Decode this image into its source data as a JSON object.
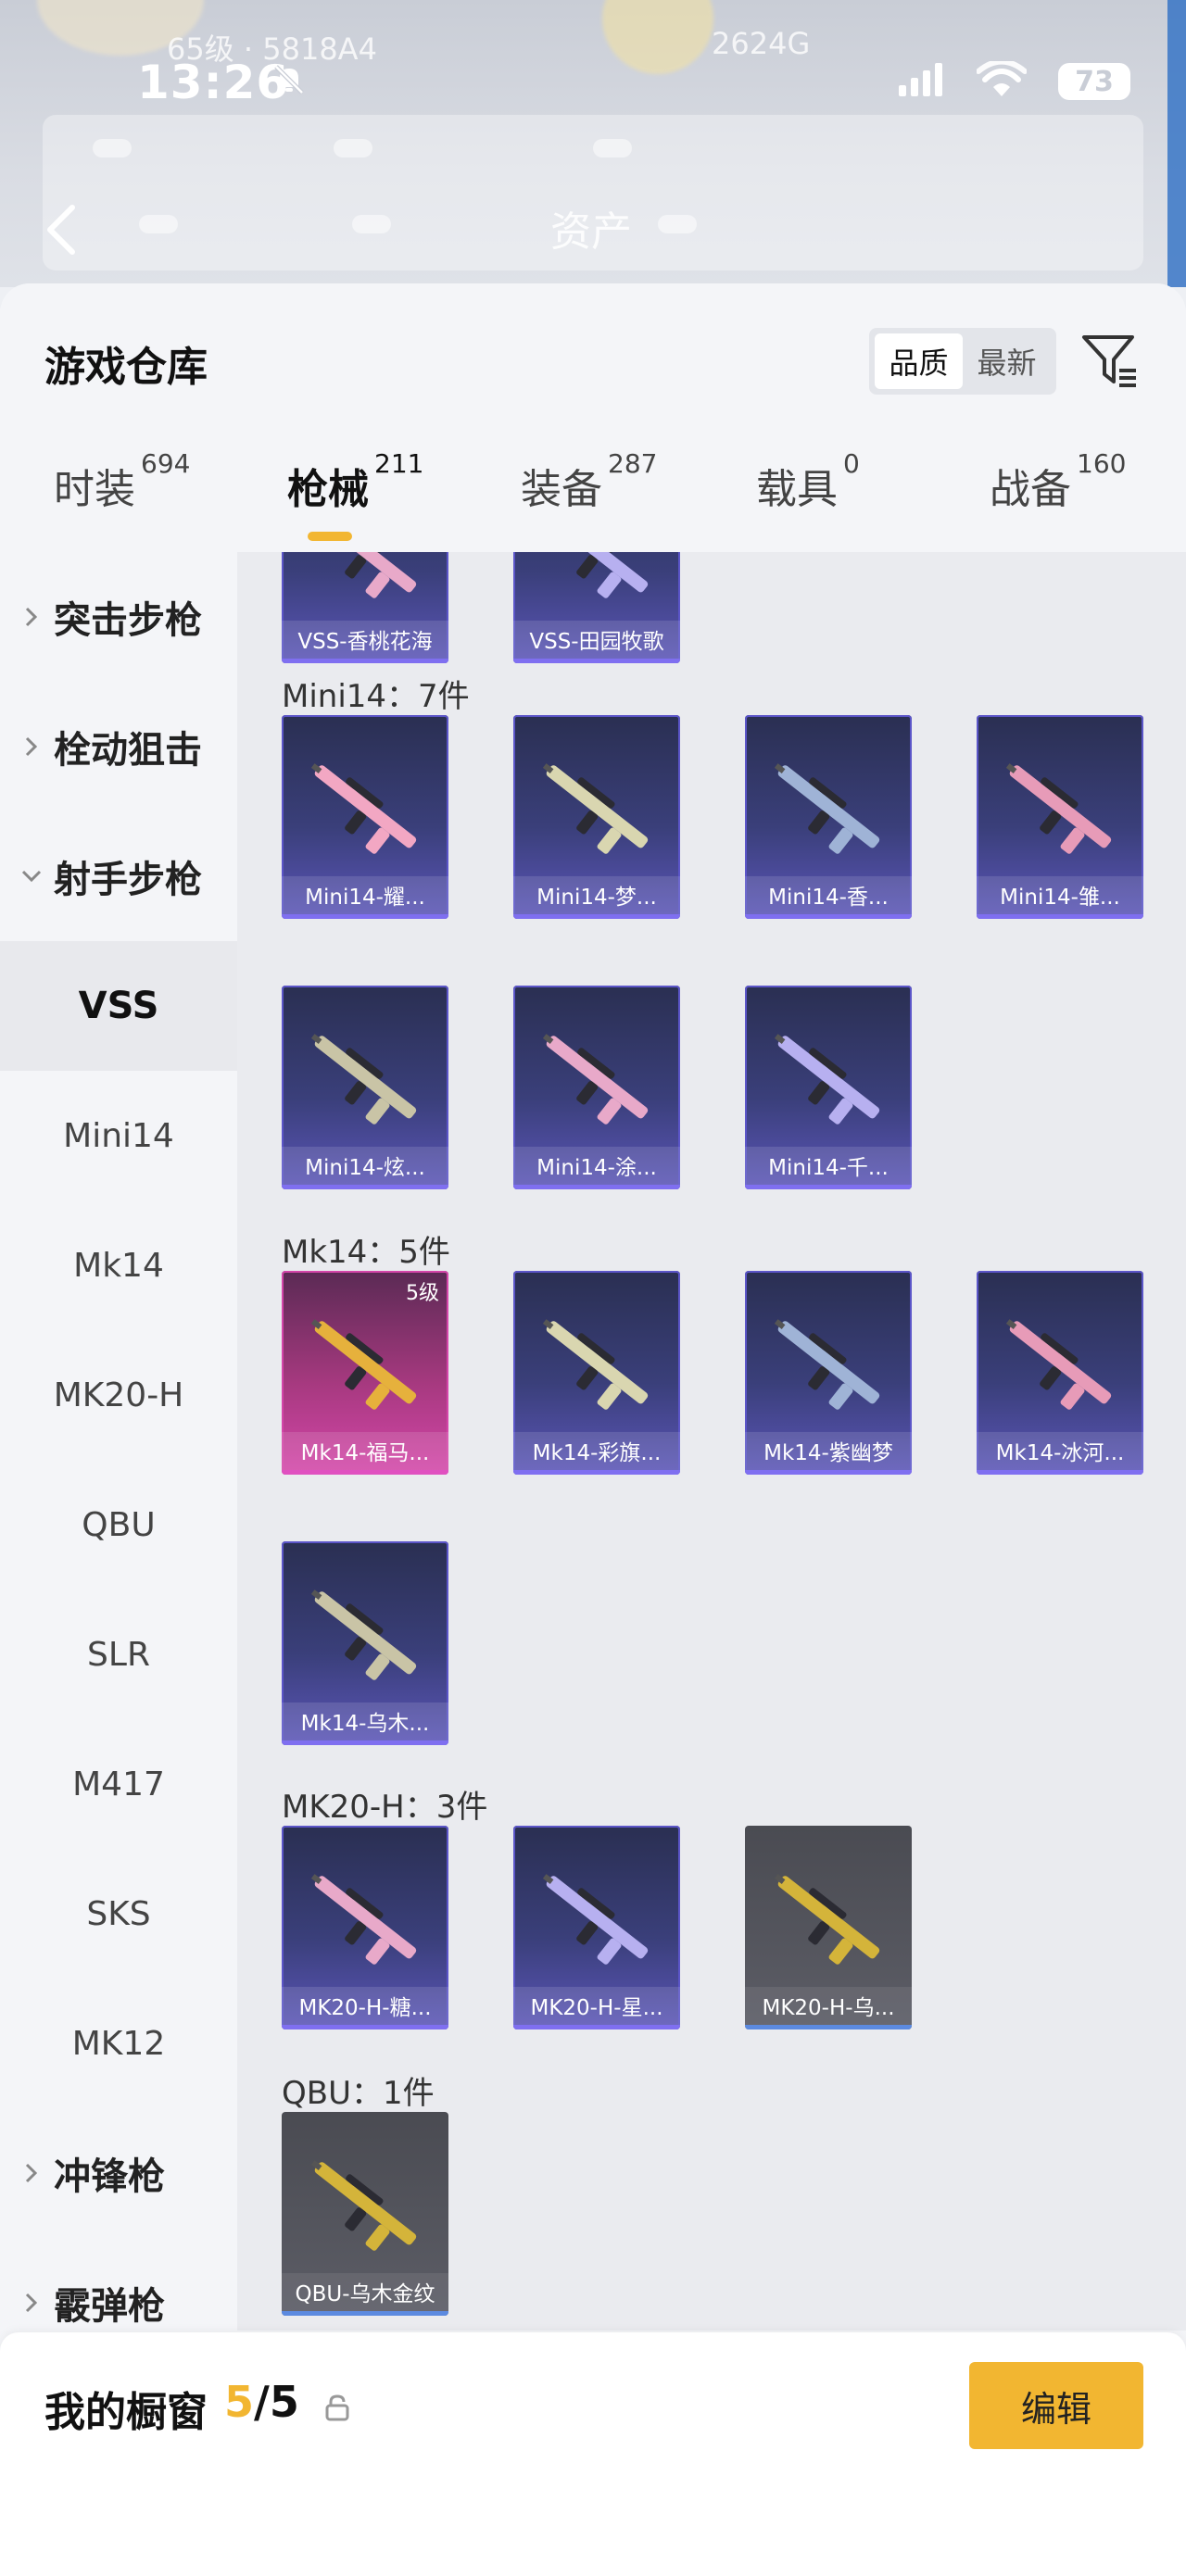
{
  "status_bar": {
    "time": "13:26",
    "battery": "73"
  },
  "background": {
    "faint_left": "65级 · 5818A4",
    "faint_right": "2624G",
    "assets_label": "资产"
  },
  "colors": {
    "accent": "#f2b631",
    "card_purple": "#3a3f7a",
    "card_pink": "#d446a9",
    "card_gray": "#5c5d66"
  },
  "sheet": {
    "title": "游戏仓库",
    "sort_options": [
      "品质",
      "最新"
    ],
    "sort_active": "品质",
    "tabs": [
      {
        "label": "时装",
        "count": "694"
      },
      {
        "label": "枪械",
        "count": "211"
      },
      {
        "label": "装备",
        "count": "287"
      },
      {
        "label": "载具",
        "count": "0"
      },
      {
        "label": "战备",
        "count": "160"
      }
    ],
    "active_tab": "枪械"
  },
  "sidebar": {
    "groups": [
      {
        "label": "突击步枪",
        "expanded": false
      },
      {
        "label": "栓动狙击",
        "expanded": false
      },
      {
        "label": "射手步枪",
        "expanded": true
      }
    ],
    "subs": [
      "VSS",
      "Mini14",
      "Mk14",
      "MK20-H",
      "QBU",
      "SLR",
      "M417",
      "SKS",
      "MK12"
    ],
    "active_sub": "VSS",
    "groups_after": [
      {
        "label": "冲锋枪",
        "expanded": false
      },
      {
        "label": "霰弹枪",
        "expanded": false
      }
    ]
  },
  "content": {
    "vss_tail": [
      {
        "name": "VSS-香桃花海",
        "rarity": "purple"
      },
      {
        "name": "VSS-田园牧歌",
        "rarity": "purple"
      }
    ],
    "groups": [
      {
        "title": "Mini14：7件",
        "items": [
          {
            "name": "Mini14-耀...",
            "rarity": "purple"
          },
          {
            "name": "Mini14-梦...",
            "rarity": "purple"
          },
          {
            "name": "Mini14-香...",
            "rarity": "purple"
          },
          {
            "name": "Mini14-雏...",
            "rarity": "purple"
          },
          {
            "name": "Mini14-炫...",
            "rarity": "purple"
          },
          {
            "name": "Mini14-涂...",
            "rarity": "purple"
          },
          {
            "name": "Mini14-千...",
            "rarity": "purple"
          }
        ]
      },
      {
        "title": "Mk14：5件",
        "items": [
          {
            "name": "Mk14-福马...",
            "rarity": "pink",
            "level": "5级"
          },
          {
            "name": "Mk14-彩旗...",
            "rarity": "purple"
          },
          {
            "name": "Mk14-紫幽梦",
            "rarity": "purple"
          },
          {
            "name": "Mk14-冰河...",
            "rarity": "purple"
          },
          {
            "name": "Mk14-乌木...",
            "rarity": "purple"
          }
        ]
      },
      {
        "title": "MK20-H：3件",
        "items": [
          {
            "name": "MK20-H-糖...",
            "rarity": "purple"
          },
          {
            "name": "MK20-H-星...",
            "rarity": "purple"
          },
          {
            "name": "MK20-H-乌...",
            "rarity": "gray"
          }
        ]
      },
      {
        "title": "QBU：1件",
        "items": [
          {
            "name": "QBU-乌木金纹",
            "rarity": "gray"
          }
        ]
      }
    ]
  },
  "footer": {
    "title": "我的橱窗",
    "current": "5",
    "total": "/5",
    "edit_label": "编辑"
  }
}
